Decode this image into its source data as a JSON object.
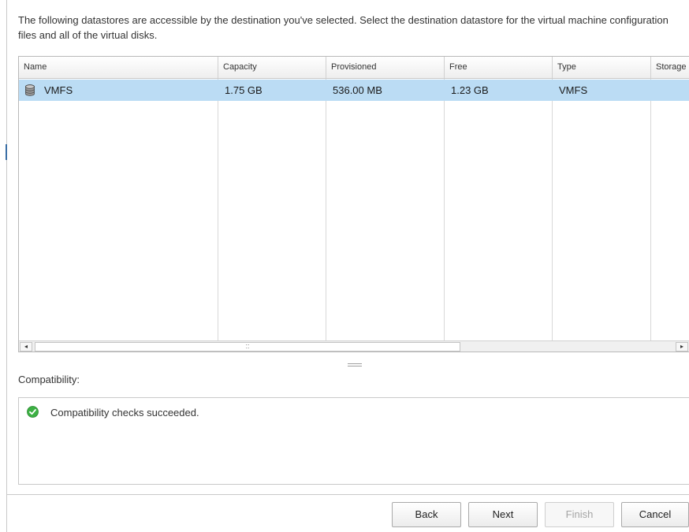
{
  "description": "The following datastores are accessible by the destination you've selected. Select the destination datastore for the virtual machine configuration files and all of the virtual disks.",
  "table": {
    "columns": [
      "Name",
      "Capacity",
      "Provisioned",
      "Free",
      "Type",
      "Storage"
    ],
    "rows": [
      {
        "icon": "database-icon",
        "name": "VMFS",
        "capacity": "1.75 GB",
        "provisioned": "536.00 MB",
        "free": "1.23 GB",
        "type": "VMFS",
        "storage": "",
        "selected": true
      }
    ]
  },
  "scrollbar": {
    "left_arrow": "◂",
    "right_arrow": "▸",
    "grip": "::"
  },
  "compatibility": {
    "label": "Compatibility:",
    "status_icon": "success-check-icon",
    "message": "Compatibility checks succeeded."
  },
  "buttons": {
    "back": "Back",
    "next": "Next",
    "finish": "Finish",
    "cancel": "Cancel"
  },
  "colors": {
    "selected_row": "#bbdcf4",
    "success": "#3cb043"
  }
}
